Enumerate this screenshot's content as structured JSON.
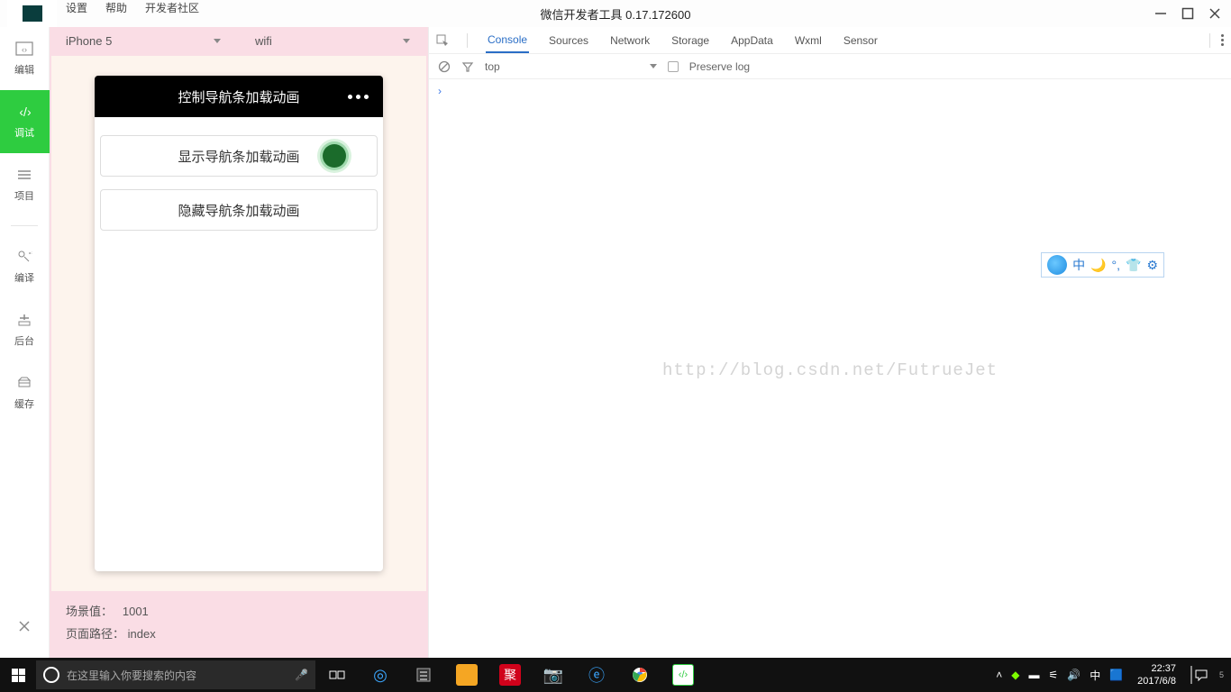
{
  "menubar": {
    "items": [
      "设置",
      "帮助",
      "开发者社区"
    ],
    "title": "微信开发者工具 0.17.172600"
  },
  "sidebar": {
    "items": [
      {
        "label": "编辑",
        "icon": "code-icon"
      },
      {
        "label": "调试",
        "icon": "debug-icon",
        "active": true
      },
      {
        "label": "项目",
        "icon": "menu-icon"
      },
      {
        "label": "编译",
        "icon": "compile-icon"
      },
      {
        "label": "后台",
        "icon": "background-icon"
      },
      {
        "label": "缓存",
        "icon": "cache-icon"
      }
    ],
    "close_label": "关"
  },
  "simulator": {
    "device": "iPhone 5",
    "network": "wifi",
    "nav_title": "控制导航条加载动画",
    "buttons": [
      "显示导航条加载动画",
      "隐藏导航条加载动画"
    ],
    "footer": {
      "scene_label": "场景值：",
      "scene_value": "1001",
      "path_label": "页面路径：",
      "path_value": "index"
    }
  },
  "devtools": {
    "tabs": [
      "Console",
      "Sources",
      "Network",
      "Storage",
      "AppData",
      "Wxml",
      "Sensor"
    ],
    "active_tab": "Console",
    "context": "top",
    "preserve_log": "Preserve log",
    "prompt": "›"
  },
  "watermark": "http://blog.csdn.net/FutrueJet",
  "ime": {
    "lang": "中"
  },
  "taskbar": {
    "search_placeholder": "在这里输入你要搜索的内容",
    "tray_lang": "中",
    "time": "22:37",
    "date": "2017/6/8",
    "notif_count": "5"
  }
}
